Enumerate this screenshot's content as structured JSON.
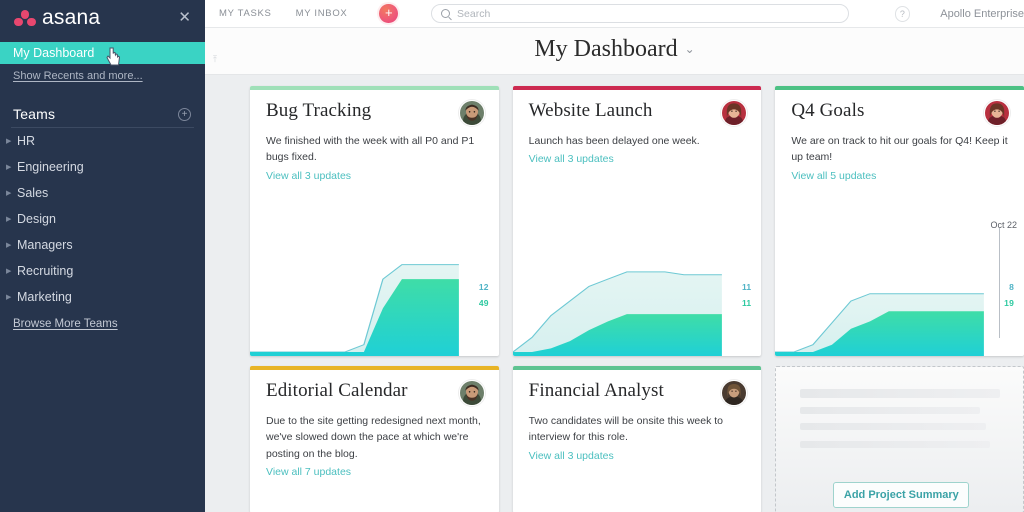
{
  "sidebar": {
    "brand": "asana",
    "close_icon": "✕",
    "active_item": "My Dashboard",
    "show_recents": "Show Recents and more...",
    "teams_header": "Teams",
    "teams_add_icon": "+",
    "teams": [
      {
        "label": "HR"
      },
      {
        "label": "Engineering"
      },
      {
        "label": "Sales"
      },
      {
        "label": "Design"
      },
      {
        "label": "Managers"
      },
      {
        "label": "Recruiting"
      },
      {
        "label": "Marketing"
      }
    ],
    "browse_more": "Browse More Teams"
  },
  "topbar": {
    "my_tasks": "MY TASKS",
    "my_inbox": "MY INBOX",
    "add_label": "+",
    "search_placeholder": "Search",
    "help_label": "?",
    "workspace": "Apollo Enterprise"
  },
  "page": {
    "title": "My Dashboard",
    "title_caret": "⌄",
    "collapse_icon": "⤒"
  },
  "cards": [
    {
      "id": "bug-tracking",
      "title": "Bug Tracking",
      "accent": "#9fe0b8",
      "text": "We finished with the week with all P0 and P1 bugs fixed.",
      "link": "View all 3 updates",
      "avatar": "male-beard",
      "chart": {
        "top_label": "12",
        "bottom_label": "49",
        "date_label": ""
      }
    },
    {
      "id": "website-launch",
      "title": "Website Launch",
      "accent": "#cc2a50",
      "text": "Launch has been delayed one week.",
      "link": "View all 3 updates",
      "avatar": "female-red",
      "chart": {
        "top_label": "11",
        "bottom_label": "11",
        "date_label": ""
      }
    },
    {
      "id": "q4-goals",
      "title": "Q4 Goals",
      "accent": "#4cc184",
      "text": "We are on track to hit our goals for Q4! Keep it up team!",
      "link": "View all 5 updates",
      "avatar": "female-red",
      "chart": {
        "top_label": "8",
        "bottom_label": "19",
        "date_label": "Oct 22"
      }
    },
    {
      "id": "editorial-calendar",
      "title": "Editorial Calendar",
      "accent": "#e8b426",
      "text": "Due to the site getting redesigned next month, we've slowed down the pace at which we're posting on the blog.",
      "link": "View all 7 updates",
      "avatar": "male-beard",
      "chart": null
    },
    {
      "id": "financial-analyst",
      "title": "Financial Analyst",
      "accent": "#5ec391",
      "text": "Two candidates will be onsite this week to interview for this role.",
      "link": "View all 3 updates",
      "avatar": "female-dark",
      "chart": null
    }
  ],
  "placeholder_card": {
    "button_label": "Add Project Summary"
  },
  "chart_data": [
    {
      "type": "area",
      "id": "bug-tracking-chart",
      "title": "Bug Tracking",
      "series": [
        {
          "name": "total",
          "values": [
            0,
            0,
            0,
            0,
            0,
            0,
            1,
            10,
            12,
            12,
            12,
            12
          ],
          "end_label": "12"
        },
        {
          "name": "completed",
          "values": [
            0,
            0,
            0,
            0,
            0,
            0,
            0,
            6,
            10,
            10,
            10,
            10
          ],
          "end_label": "49"
        }
      ],
      "ylim": [
        0,
        14
      ],
      "grid": false,
      "legend": "none"
    },
    {
      "type": "area",
      "id": "website-launch-chart",
      "title": "Website Launch",
      "series": [
        {
          "name": "total",
          "values": [
            0,
            2,
            5,
            7,
            9,
            10,
            11,
            11,
            11,
            10.6,
            10.6,
            10.6
          ],
          "end_label": "11"
        },
        {
          "name": "completed",
          "values": [
            0,
            0,
            0.5,
            1.5,
            3,
            4.2,
            5.2,
            5.2,
            5.2,
            5.2,
            5.2,
            5.2
          ],
          "end_label": "11"
        }
      ],
      "ylim": [
        0,
        14
      ],
      "grid": false,
      "legend": "none"
    },
    {
      "type": "area",
      "id": "q4-goals-chart",
      "title": "Q4 Goals",
      "series": [
        {
          "name": "total",
          "values": [
            0,
            0,
            1,
            4,
            7,
            8,
            8,
            8,
            8,
            8,
            8,
            8
          ],
          "end_label": "8"
        },
        {
          "name": "completed",
          "values": [
            0,
            0,
            0,
            1,
            3.2,
            4.2,
            5.6,
            5.6,
            5.6,
            5.6,
            5.6,
            5.6
          ],
          "end_label": "19"
        }
      ],
      "annotation": {
        "label": "Oct 22",
        "x_fraction": 0.78
      },
      "ylim": [
        0,
        14
      ],
      "grid": false,
      "legend": "none"
    }
  ]
}
